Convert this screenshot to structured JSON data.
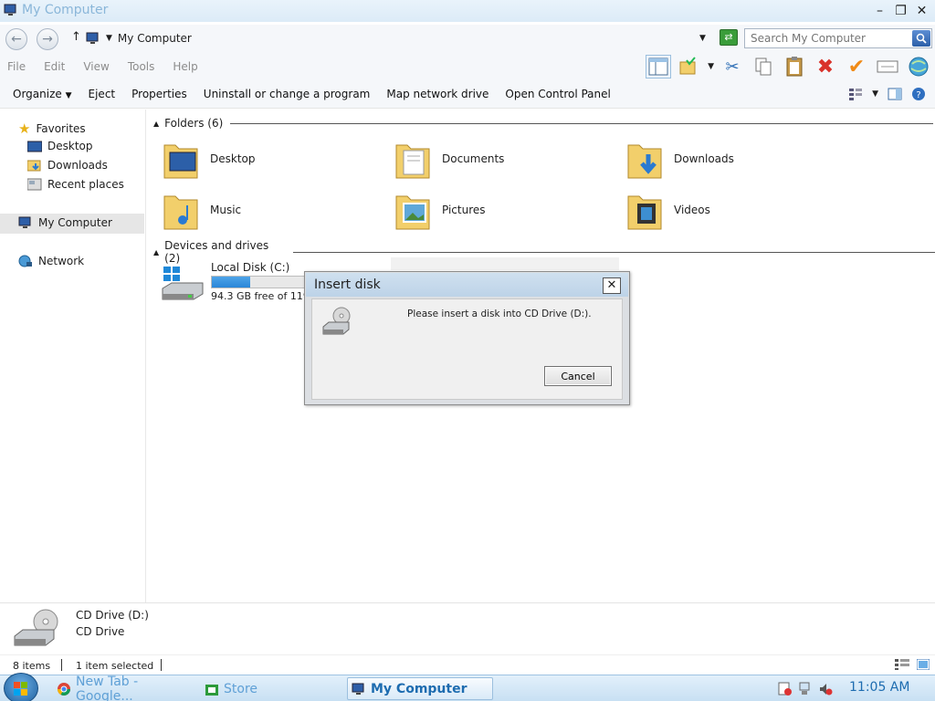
{
  "window": {
    "title": "My Computer"
  },
  "address": {
    "path": "My Computer"
  },
  "search": {
    "placeholder": "Search My Computer"
  },
  "menubar": [
    "File",
    "Edit",
    "View",
    "Tools",
    "Help"
  ],
  "commands": [
    "Organize",
    "Eject",
    "Properties",
    "Uninstall or change a program",
    "Map network drive",
    "Open Control Panel"
  ],
  "nav": {
    "favorites": "Favorites",
    "desktop": "Desktop",
    "downloads": "Downloads",
    "recent": "Recent places",
    "computer": "My Computer",
    "network": "Network"
  },
  "groups": {
    "folders": "Folders (6)",
    "devices": "Devices and drives (2)"
  },
  "folders": [
    "Desktop",
    "Documents",
    "Downloads",
    "Music",
    "Pictures",
    "Videos"
  ],
  "drive": {
    "name": "Local Disk (C:)",
    "free": "94.3 GB free of 119 GB",
    "used_fraction": 0.21
  },
  "dialog": {
    "title": "Insert disk",
    "message": "Please insert a disk into CD Drive (D:).",
    "cancel": "Cancel"
  },
  "details": {
    "name": "CD Drive (D:)",
    "type": "CD Drive"
  },
  "status": {
    "items": "8 items",
    "selected": "1 item selected"
  },
  "taskbar": {
    "tasks": [
      "New Tab - Google...",
      "Store",
      "My Computer"
    ],
    "clock": "11:05 AM"
  },
  "colors": {
    "accent": "#1d6cb0",
    "progress": "#2a86d8"
  }
}
